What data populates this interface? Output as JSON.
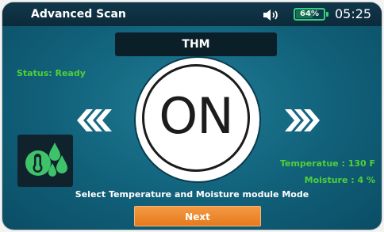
{
  "header": {
    "title": "Advanced Scan",
    "battery_percent": "64%",
    "battery_level": 0.64,
    "time": "05:25"
  },
  "module": {
    "name": "THM",
    "status": "Status: Ready",
    "state_label": "ON"
  },
  "readings": {
    "temperature": "Temperatue : 130 F",
    "moisture": "Moisture : 4 %"
  },
  "prompt": "Select Temperature and Moisture module Mode",
  "actions": {
    "next_label": "Next"
  },
  "icons": {
    "volume": "speaker-icon",
    "battery": "battery-icon",
    "left": "chevron-left-icon",
    "right": "chevron-right-icon",
    "module": "thermometer-droplet-icon"
  },
  "colors": {
    "accent_green": "#4fd135",
    "next_button": "#e67a1d",
    "background": "#11607a"
  }
}
